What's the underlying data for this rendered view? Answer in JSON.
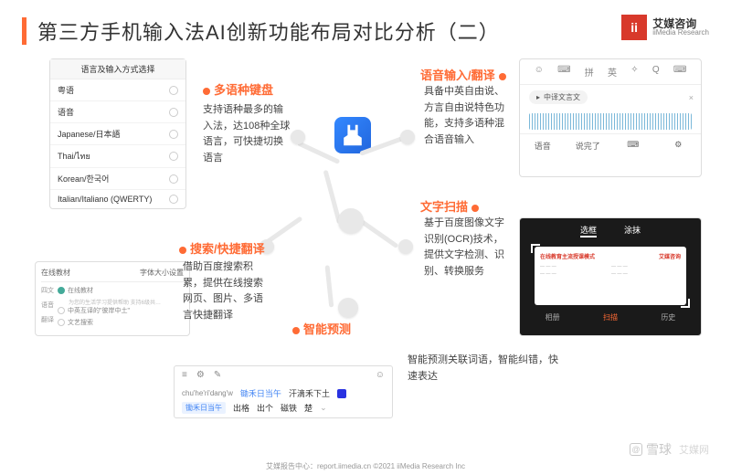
{
  "title": "第三方手机输入法AI创新功能布局对比分析（二）",
  "logo": {
    "mark": "ii",
    "cn": "艾媒咨询",
    "en": "iiMedia Research"
  },
  "labels": {
    "multilang": "多语种键盘",
    "voice": "语音输入/翻译",
    "search": "搜索/快捷翻译",
    "ocr": "文字扫描",
    "predict": "智能预测"
  },
  "desc": {
    "multilang": "支持语种最多的输入法，达108种全球语言，可快捷切换语言",
    "voice": "具备中英自由说、方言自由说特色功能，支持多语种混合语音输入",
    "search": "借助百度搜索积累，提供在线搜索网页、图片、多语言快捷翻译",
    "ocr": "基于百度图像文字识别(OCR)技术，提供文字检测、识别、转换服务",
    "predict": "智能预测关联词语，智能纠错，快速表达"
  },
  "panel_lang": {
    "header": "语言及输入方式选择",
    "items": [
      "粤语",
      "语音",
      "Japanese/日本語",
      "Thai/ไทย",
      "Korean/한국어",
      "Italian/Italiano (QWERTY)"
    ]
  },
  "panel_settings": {
    "left_tab": "在线教材",
    "right_tab": "字体大小设置",
    "tabs": [
      "四文",
      "语音",
      "翻译"
    ],
    "opt_main": "在线教材",
    "opt_desc1": "为您的生活学习提供帮助 支持6级共…",
    "opt2": "中英互译的\"彼岸中土\"",
    "opt3": "文艺搜索"
  },
  "panel_voice": {
    "mode_icons": [
      "☺",
      "⌨",
      "拼",
      "英",
      "✧",
      "Q",
      "⌨"
    ],
    "pill_icon": "▸",
    "pill": "中译文言文",
    "close": "×",
    "bottom": [
      "语音",
      "说完了",
      "⌨",
      "⚙"
    ]
  },
  "panel_ocr": {
    "tabs": [
      "选框",
      "涂抹"
    ],
    "card_title": "在线教育主流授课模式",
    "card_logo": "艾媒咨询",
    "bottom_icons": [
      "相册",
      "扫描",
      "历史"
    ]
  },
  "panel_ime": {
    "top_icons": [
      "≡",
      "⚙",
      "✎",
      "☺"
    ],
    "pinyin": "chu'he'ri'dang'w",
    "highlight": "锄禾日当午",
    "suffix": "汗滴禾下土",
    "baidu_mark": "●",
    "tag": "锄禾日当午",
    "cands": [
      "出格",
      "出个",
      "磁铁",
      "楚"
    ]
  },
  "footer": "艾媒报告中心：report.iimedia.cn   ©2021 iiMedia Research Inc",
  "watermark": {
    "icon": "@",
    "cn": "雪球",
    "sub": "艾媒网"
  }
}
